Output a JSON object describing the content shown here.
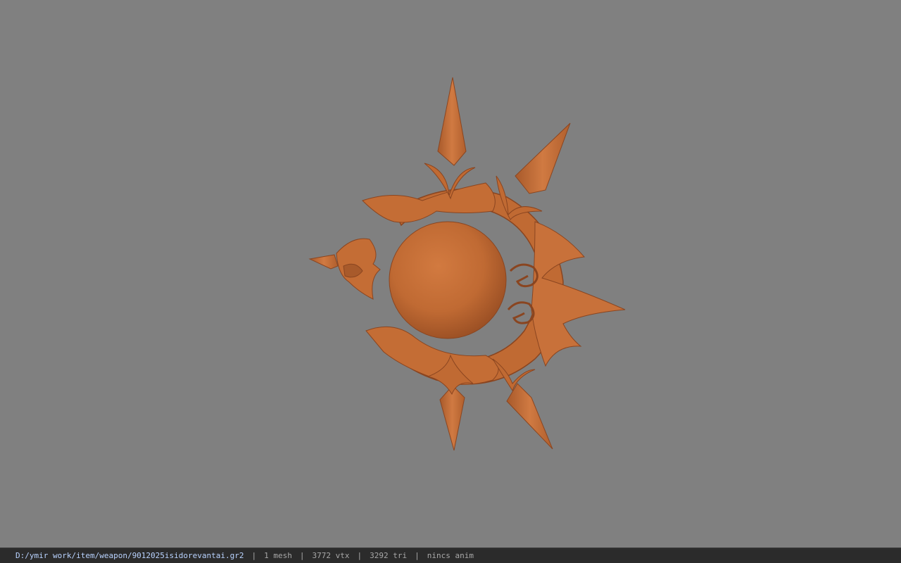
{
  "viewport": {
    "model_color": "#c06a33",
    "model_highlight": "#d98548",
    "model_shadow": "#8a4520",
    "background_color": "#808080"
  },
  "statusbar": {
    "file_path": "D:/ymir work/item/weapon/9012025isidorevantai.gr2",
    "mesh_count": "1 mesh",
    "vertex_count": "3772 vtx",
    "triangle_count": "3292 tri",
    "anim_status": "nincs anim",
    "separator": "|"
  }
}
